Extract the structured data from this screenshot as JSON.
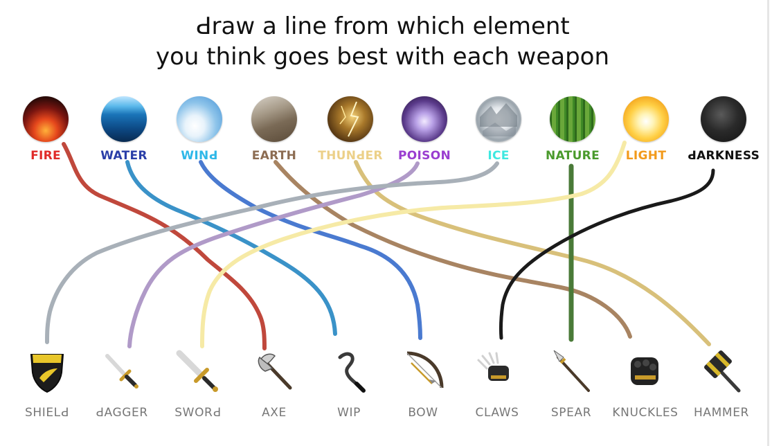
{
  "title": {
    "line1": "Ԁraw a line from which element",
    "line2": "you think goes best with each weapon"
  },
  "elements": [
    {
      "id": "fire",
      "label": "FIRE",
      "color": "#e02a28"
    },
    {
      "id": "water",
      "label": "WATER",
      "color": "#2a3ea8"
    },
    {
      "id": "wind",
      "label": "WINԀ",
      "color": "#2fb8e8"
    },
    {
      "id": "earth",
      "label": "EARTH",
      "color": "#8c6c52"
    },
    {
      "id": "thunder",
      "label": "THUNԀER",
      "color": "#ecd088"
    },
    {
      "id": "poison",
      "label": "POISON",
      "color": "#9a3ed0"
    },
    {
      "id": "ice",
      "label": "ICE",
      "color": "#3ee8e0"
    },
    {
      "id": "nature",
      "label": "NATURE",
      "color": "#4a9a2c"
    },
    {
      "id": "light",
      "label": "LIGHT",
      "color": "#f29a1c"
    },
    {
      "id": "darkness",
      "label": "ԀARKNESS",
      "color": "#111111"
    }
  ],
  "weapons": [
    {
      "id": "shield",
      "label": "SHIELԀ"
    },
    {
      "id": "dagger",
      "label": "ԀAGGER"
    },
    {
      "id": "sword",
      "label": "SWORԀ"
    },
    {
      "id": "axe",
      "label": "AXE"
    },
    {
      "id": "wip",
      "label": "WIP"
    },
    {
      "id": "bow",
      "label": "BOW"
    },
    {
      "id": "claws",
      "label": "CLAWS"
    },
    {
      "id": "spear",
      "label": "SPEAR"
    },
    {
      "id": "knuckles",
      "label": "KNUCKLES"
    },
    {
      "id": "hammer",
      "label": "HAMMER"
    }
  ],
  "connections": [
    {
      "element": "fire",
      "weapon": "axe",
      "color": "#c0483c"
    },
    {
      "element": "water",
      "weapon": "wip",
      "color": "#3a92c8"
    },
    {
      "element": "wind",
      "weapon": "bow",
      "color": "#4a7ad0"
    },
    {
      "element": "earth",
      "weapon": "knuckles",
      "color": "#a88462"
    },
    {
      "element": "thunder",
      "weapon": "hammer",
      "color": "#d8c07a"
    },
    {
      "element": "poison",
      "weapon": "dagger",
      "color": "#b09ac8"
    },
    {
      "element": "ice",
      "weapon": "shield",
      "color": "#a8b0b8"
    },
    {
      "element": "nature",
      "weapon": "spear",
      "color": "#4a7a38"
    },
    {
      "element": "light",
      "weapon": "sword",
      "color": "#f6eaa6"
    },
    {
      "element": "darkness",
      "weapon": "claws",
      "color": "#1a1a1a"
    }
  ]
}
